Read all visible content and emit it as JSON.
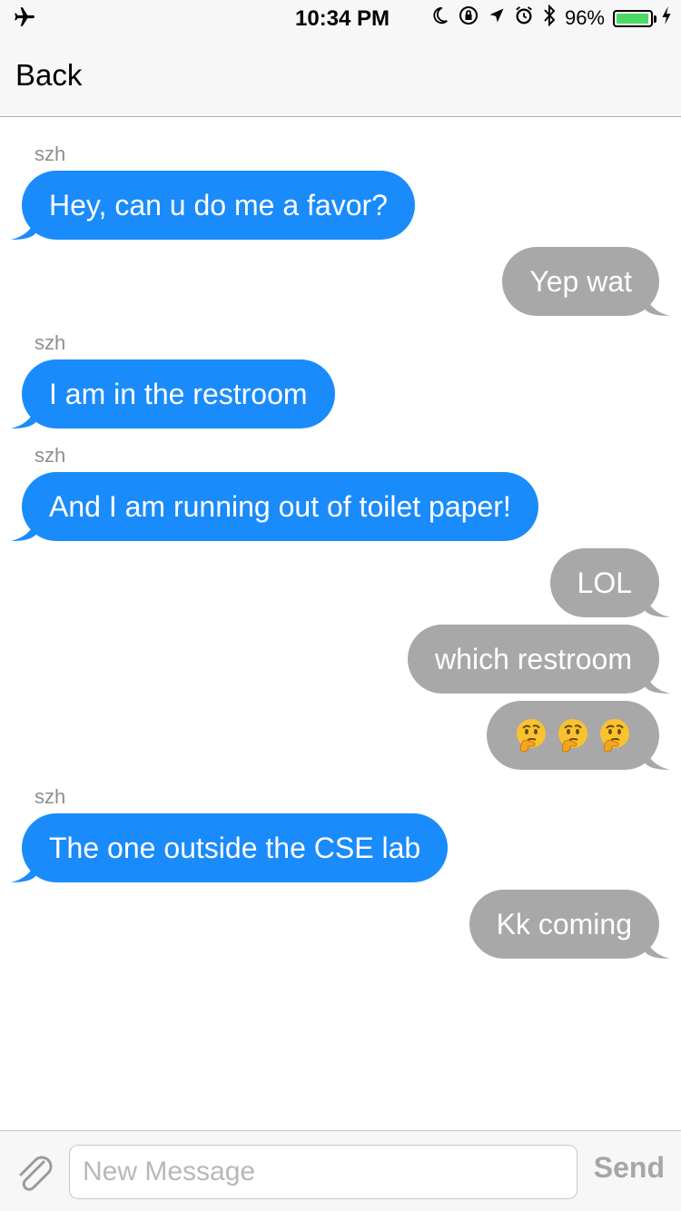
{
  "status_bar": {
    "time": "10:34 PM",
    "battery_percent_label": "96%",
    "battery_level": 0.96,
    "battery_color": "#4cd964",
    "icons": [
      "airplane-icon",
      "moon-icon",
      "orientation-lock-icon",
      "location-icon",
      "alarm-icon",
      "bluetooth-icon",
      "charging-icon"
    ]
  },
  "nav": {
    "back_label": "Back"
  },
  "conversation": {
    "incoming_color": "#1a8bfb",
    "outgoing_color": "#a8a8a8",
    "messages": [
      {
        "from": "szh",
        "direction": "incoming",
        "text": "Hey, can u do me a favor?"
      },
      {
        "from": "me",
        "direction": "outgoing",
        "text": "Yep wat"
      },
      {
        "from": "szh",
        "direction": "incoming",
        "text": "I am in the restroom"
      },
      {
        "from": "szh",
        "direction": "incoming",
        "text": "And I am running out of toilet paper!"
      },
      {
        "from": "me",
        "direction": "outgoing",
        "text": "LOL"
      },
      {
        "from": "me",
        "direction": "outgoing",
        "text": "which restroom"
      },
      {
        "from": "me",
        "direction": "outgoing",
        "text": "🤔🤔🤔",
        "emoji": [
          "thinking-face-emoji",
          "thinking-face-emoji",
          "thinking-face-emoji"
        ]
      },
      {
        "from": "szh",
        "direction": "incoming",
        "text": "The one outside the CSE lab"
      },
      {
        "from": "me",
        "direction": "outgoing",
        "text": "Kk coming"
      }
    ]
  },
  "input_bar": {
    "placeholder": "New Message",
    "value": "",
    "send_label": "Send",
    "attach_icon": "paperclip-icon"
  }
}
